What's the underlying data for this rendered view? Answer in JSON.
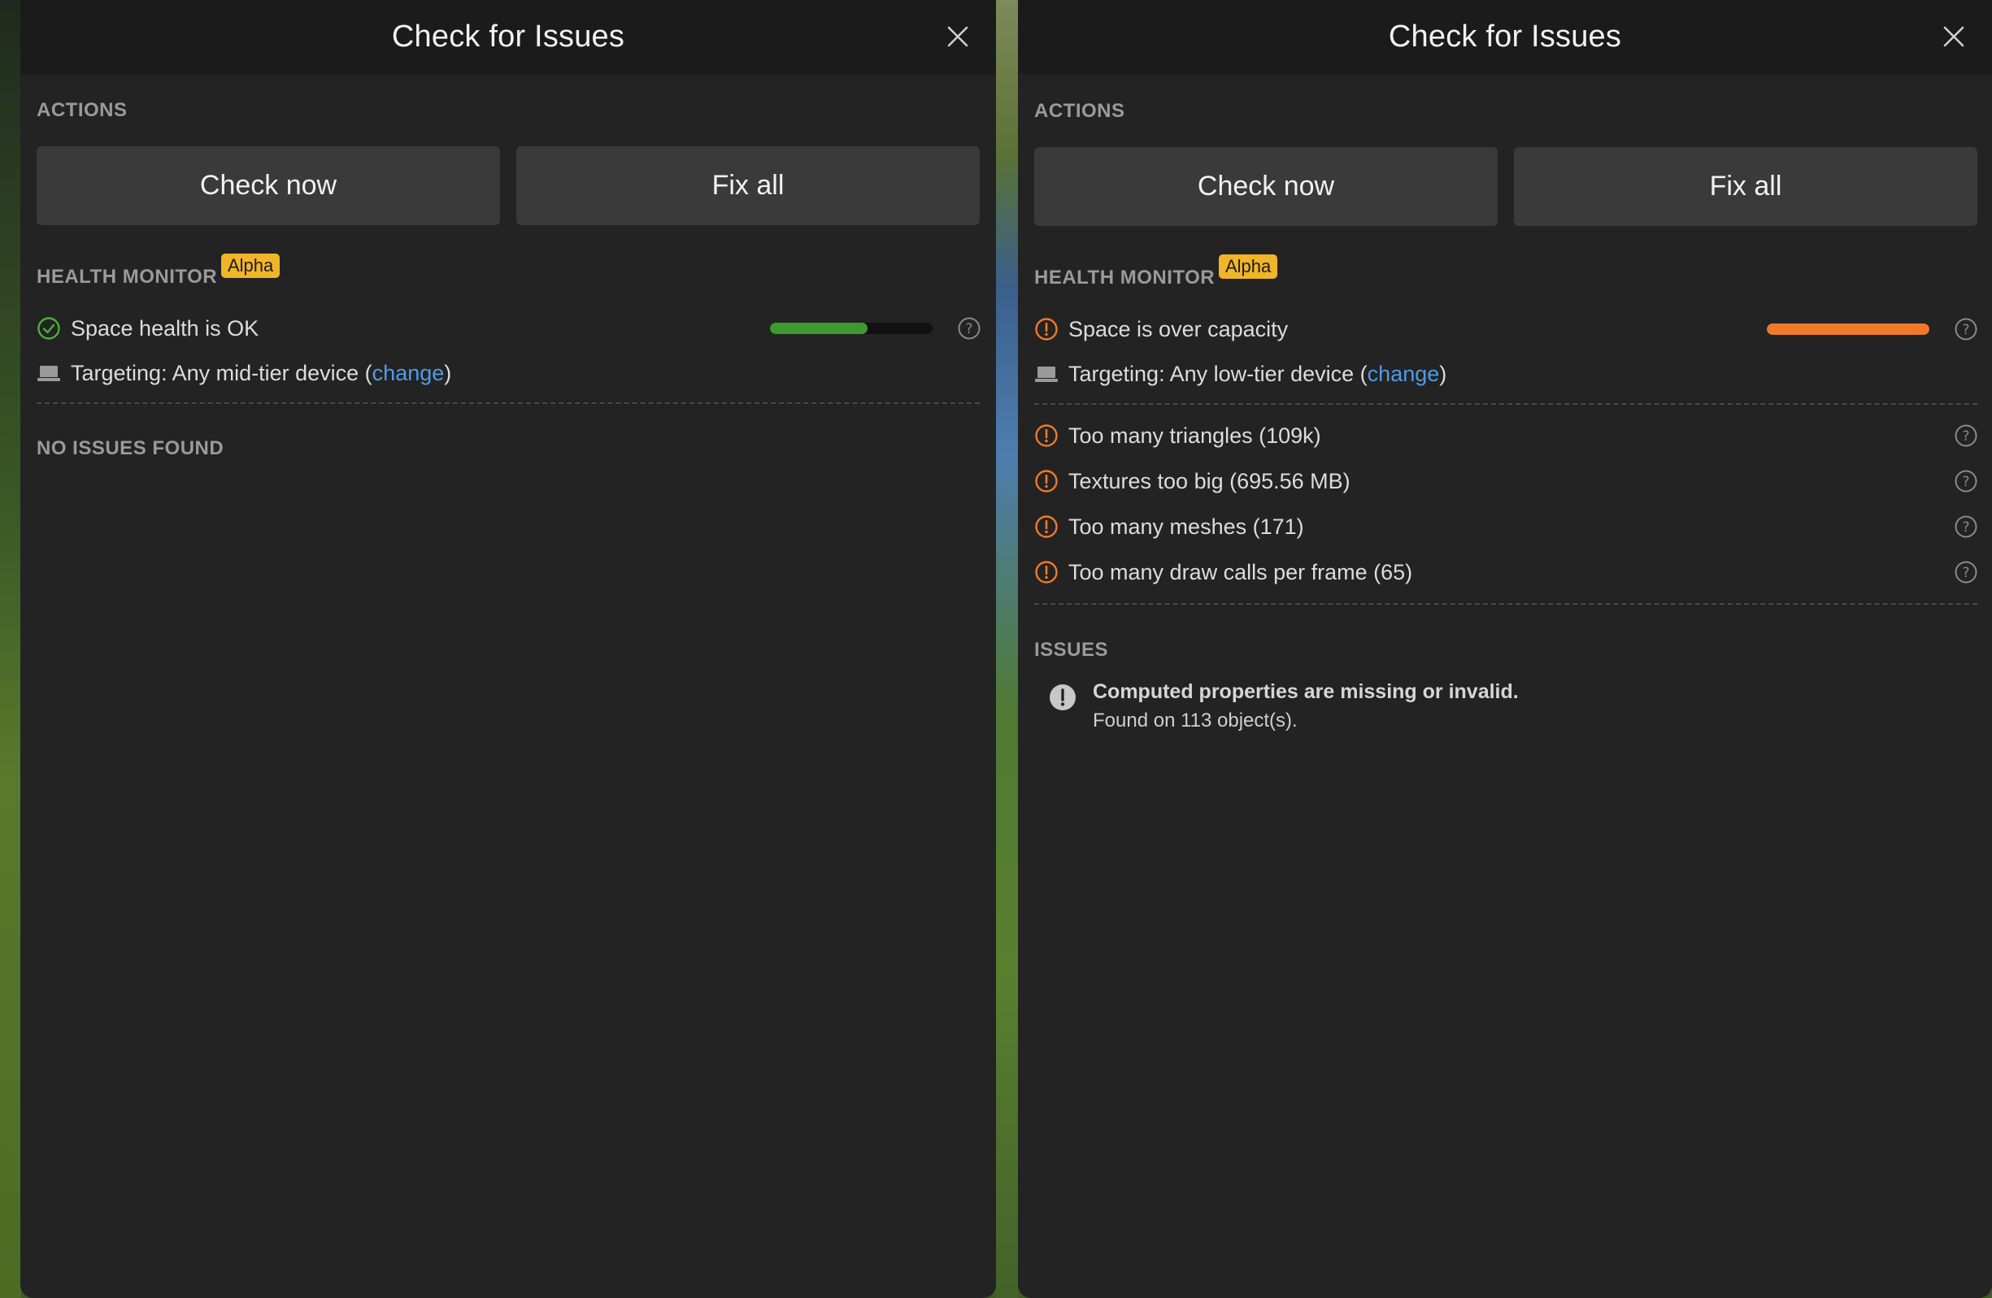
{
  "colors": {
    "ok_green": "#4caf3c",
    "warn_orange": "#f07a2a",
    "link_blue": "#4f9be8",
    "badge_yellow": "#f1b529"
  },
  "left_panel": {
    "title": "Check for Issues",
    "actions_label": "ACTIONS",
    "check_now": "Check now",
    "fix_all": "Fix all",
    "health_label": "HEALTH MONITOR",
    "badge": "Alpha",
    "status_text": "Space health is OK",
    "status_icon": "check-circle-icon",
    "health_fill": 0.6,
    "targeting_prefix": "Targeting: Any mid-tier device (",
    "targeting_link": "change",
    "targeting_suffix": ")",
    "no_issues": "NO ISSUES FOUND"
  },
  "right_panel": {
    "title": "Check for Issues",
    "actions_label": "ACTIONS",
    "check_now": "Check now",
    "fix_all": "Fix all",
    "health_label": "HEALTH MONITOR",
    "badge": "Alpha",
    "status_text": "Space is over capacity",
    "status_icon": "warning-circle-icon",
    "health_fill": 1.0,
    "targeting_prefix": "Targeting: Any low-tier device (",
    "targeting_link": "change",
    "targeting_suffix": ")",
    "warnings": [
      {
        "text": "Too many triangles (109k)"
      },
      {
        "text": "Textures too big (695.56 MB)"
      },
      {
        "text": "Too many meshes (171)"
      },
      {
        "text": "Too many draw calls per frame (65)"
      }
    ],
    "issues_label": "ISSUES",
    "issue": {
      "title": "Computed properties are missing or invalid.",
      "detail": "Found on 113 object(s)."
    }
  }
}
